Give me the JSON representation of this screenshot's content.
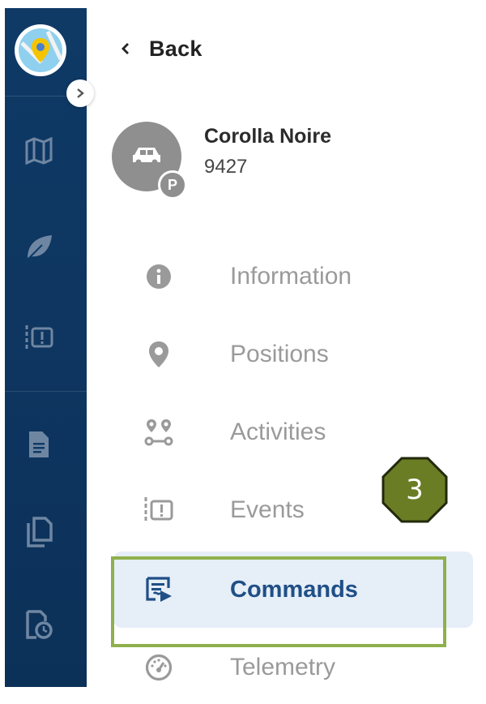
{
  "header": {
    "back_label": "Back"
  },
  "vehicle": {
    "name": "Corolla Noire",
    "id": "9427",
    "status_badge": "P"
  },
  "menu": {
    "items": [
      {
        "label": "Information",
        "icon": "info-icon",
        "active": false
      },
      {
        "label": "Positions",
        "icon": "location-pin-icon",
        "active": false
      },
      {
        "label": "Activities",
        "icon": "activities-route-icon",
        "active": false
      },
      {
        "label": "Events",
        "icon": "events-alert-icon",
        "active": false
      },
      {
        "label": "Commands",
        "icon": "commands-icon",
        "active": true
      },
      {
        "label": "Telemetry",
        "icon": "gauge-icon",
        "active": false
      }
    ]
  },
  "rail": {
    "icons": [
      "app-logo-icon",
      "map-icon",
      "leaf-icon",
      "events-alert-icon",
      "document-icon",
      "copy-icon",
      "report-clock-icon"
    ]
  },
  "annotation": {
    "step_number": "3"
  },
  "colors": {
    "rail": "#0f3a66",
    "active_bg": "#e6eef8",
    "active_text": "#1f4f86",
    "inactive_text": "#9a9a9a",
    "annotation_green": "#8fb04c",
    "marker_fill": "#6a7d24"
  }
}
